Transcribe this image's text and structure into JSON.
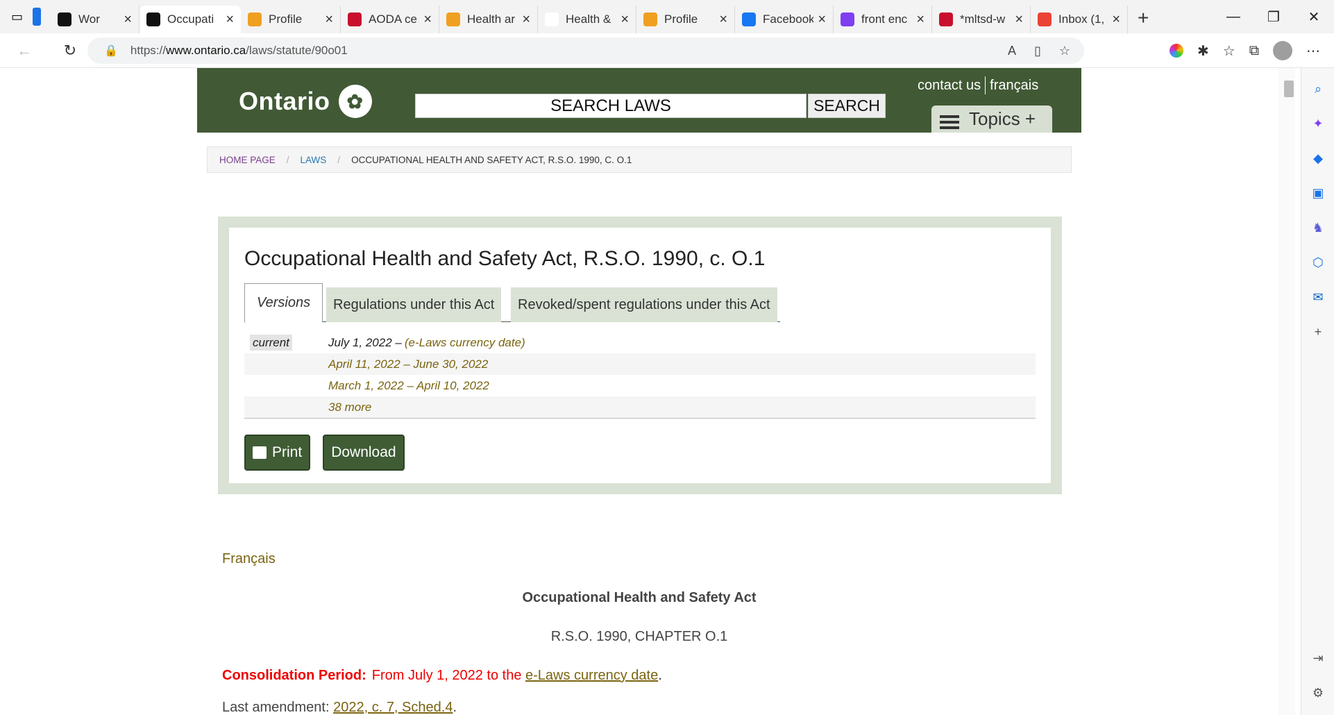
{
  "browser": {
    "tabs": [
      {
        "title": "Wor",
        "favicon_color": "#111111"
      },
      {
        "title": "Occupati",
        "favicon_color": "#111111",
        "active": true
      },
      {
        "title": "Profile",
        "favicon_color": "#f0a020"
      },
      {
        "title": "AODA ce",
        "favicon_color": "#c8102e"
      },
      {
        "title": "Health ar",
        "favicon_color": "#f0a020"
      },
      {
        "title": "Health &",
        "favicon_color": "#ffffff"
      },
      {
        "title": "Profile",
        "favicon_color": "#f0a020"
      },
      {
        "title": "Facebook",
        "favicon_color": "#1877f2"
      },
      {
        "title": "front enc",
        "favicon_color": "#7e3ff2"
      },
      {
        "title": "*mltsd-w",
        "favicon_color": "#c8102e"
      },
      {
        "title": "Inbox (1,",
        "favicon_color": "#ea4335"
      }
    ],
    "new_tab": "+",
    "url_prefix": "https://",
    "url_host": "www.ontario.ca",
    "url_path": "/laws/statute/90o01"
  },
  "site": {
    "logo_text": "Ontario",
    "search_placeholder": "SEARCH LAWS",
    "search_button": "SEARCH",
    "contact_link": "contact us",
    "french_link": "français",
    "topics_label": "Topics +"
  },
  "breadcrumb": {
    "home": "HOME PAGE",
    "laws": "LAWS",
    "current": "OCCUPATIONAL HEALTH AND SAFETY ACT, R.S.O. 1990, C. O.1"
  },
  "act": {
    "title": "Occupational Health and Safety Act, R.S.O. 1990, c. O.1",
    "tabs": [
      "Versions",
      "Regulations under this Act",
      "Revoked/spent regulations under this Act"
    ],
    "versions": [
      {
        "label": "current",
        "date": "July 1, 2022 – ",
        "link": "(e-Laws currency date)"
      },
      {
        "label": "",
        "date": "",
        "link": "April 11, 2022 – June 30, 2022"
      },
      {
        "label": "",
        "date": "",
        "link": "March 1, 2022 – April 10, 2022"
      },
      {
        "label": "",
        "date": "",
        "link": "38 more"
      }
    ],
    "print_button": "Print",
    "download_button": "Download"
  },
  "body": {
    "french_link": "Français",
    "statute_title": "Occupational Health and Safety Act",
    "chapter": "R.S.O. 1990, CHAPTER O.1",
    "consolidation_label": "Consolidation Period:",
    "consolidation_text": "From July 1, 2022 to the ",
    "consolidation_link": "e-Laws currency date",
    "consolidation_end": ".",
    "last_amendment_label": "Last amendment: ",
    "last_amendment_link": "2022, c. 7, Sched.4",
    "last_amendment_end": "."
  }
}
